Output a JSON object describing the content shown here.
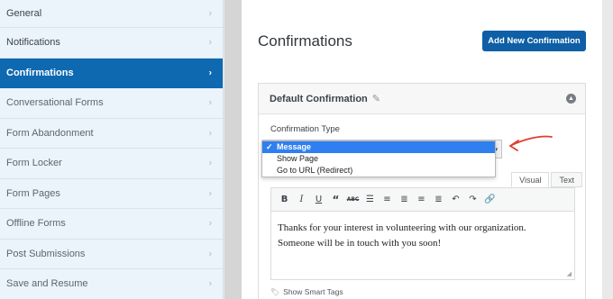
{
  "sidebar": {
    "items": [
      {
        "label": "General"
      },
      {
        "label": "Notifications"
      },
      {
        "label": "Confirmations"
      },
      {
        "label": "Conversational Forms"
      },
      {
        "label": "Form Abandonment"
      },
      {
        "label": "Form Locker"
      },
      {
        "label": "Form Pages"
      },
      {
        "label": "Offline Forms"
      },
      {
        "label": "Post Submissions"
      },
      {
        "label": "Save and Resume"
      }
    ]
  },
  "main": {
    "title": "Confirmations",
    "add_button": "Add New Confirmation",
    "card_title": "Default Confirmation",
    "field_label": "Confirmation Type",
    "dropdown": {
      "options": [
        "Message",
        "Show Page",
        "Go to URL (Redirect)"
      ],
      "selected": "Message"
    },
    "tabs": {
      "visual": "Visual",
      "text": "Text"
    },
    "editor": {
      "line1": "Thanks for your interest in volunteering with our organization.",
      "line2": "Someone will be in touch with you soon!"
    },
    "smart_tags": "Show Smart Tags"
  },
  "colors": {
    "accent": "#0e69b1",
    "button": "#0e5fa6",
    "selected_option": "#2f7ff0",
    "annotation_arrow": "#e0402e"
  }
}
